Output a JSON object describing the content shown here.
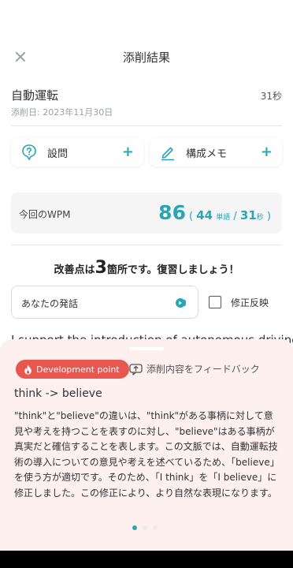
{
  "header": {
    "title": "添削結果"
  },
  "topic": {
    "title": "自動運転",
    "duration": "31秒",
    "date": "添削日: 2023年11月30日"
  },
  "buttons": {
    "question": "設問",
    "memo": "構成メモ",
    "plus": "+"
  },
  "wpm": {
    "label": "今回のWPM",
    "value": "86",
    "paren_open": "(",
    "words": "44",
    "words_unit": "単語",
    "slash": "/",
    "seconds": "31",
    "seconds_unit": "秒",
    "paren_close": ")"
  },
  "improve": {
    "prefix": "改善点は",
    "count": "3",
    "suffix": "箇所です。復習しましょう！"
  },
  "speech": {
    "label": "あなたの発話",
    "checkbox_label": "修正反映"
  },
  "essay": {
    "text": "I support the introduction of autonomous driving"
  },
  "sheet": {
    "badge": "Development point",
    "feedback": "添削内容をフィードバック",
    "change": "think -> believe",
    "explanation": "\"think\"と\"believe\"の違いは、\"think\"がある事柄に対して意見や考えを持つことを表すのに対し、\"believe\"はある事柄が真実だと確信することを表します。この文脈では、自動運転技術の導入についての意見や考えを述べているため、「believe」を使う方が適切です。そのため、「I think」を「I believe」に修正しました。この修正により、より自然な表現になります。",
    "pages": 3,
    "current_page": 1
  },
  "colors": {
    "accent": "#2aa5b8",
    "badge": "#e8574f",
    "sheet_bg": "#fdf0ef"
  },
  "icons": [
    "close-icon",
    "question-icon",
    "pencil-icon",
    "audio-icon",
    "flame-icon",
    "feedback-icon"
  ]
}
